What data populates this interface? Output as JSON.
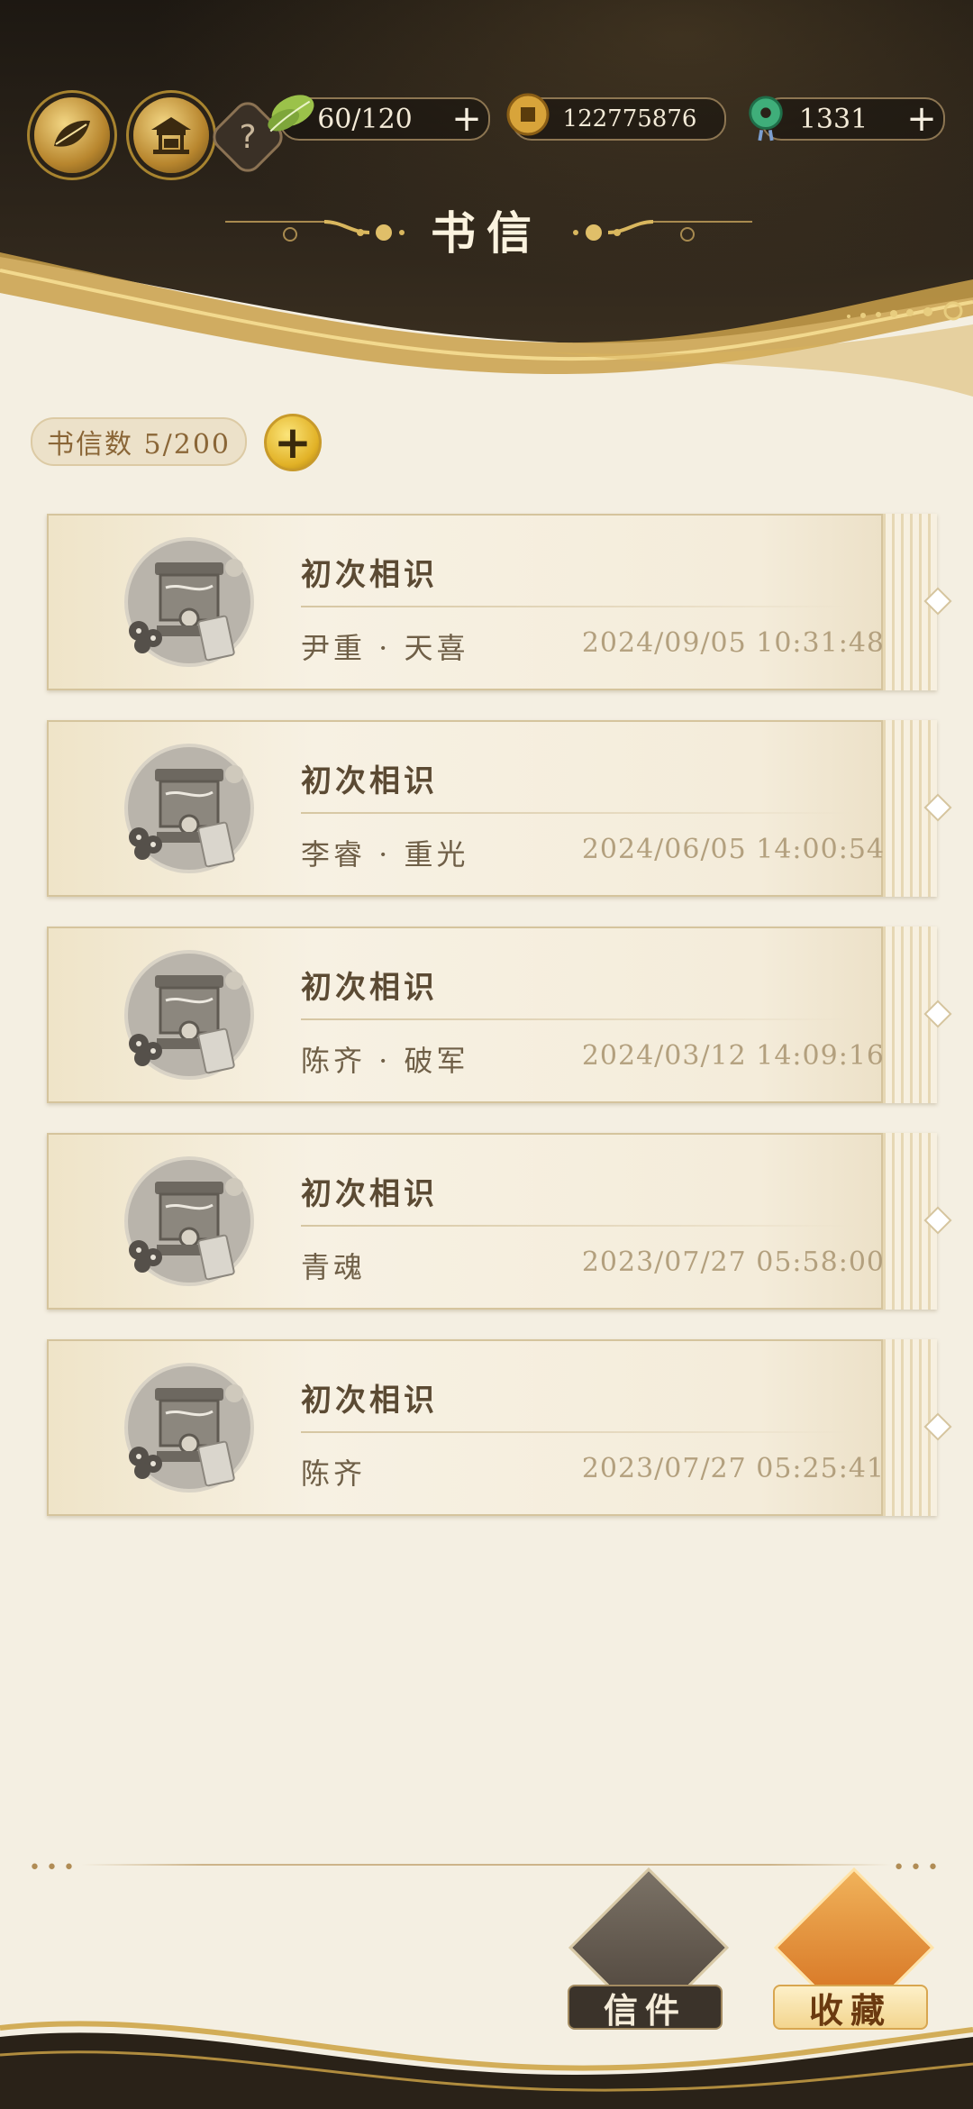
{
  "header": {
    "title": "书信",
    "resources": {
      "stamina": {
        "icon": "leaf-icon",
        "value": "60/120"
      },
      "coins": {
        "icon": "copper-coin-icon",
        "value": "122775876"
      },
      "jade": {
        "icon": "jade-pendant-icon",
        "value": "1331"
      }
    },
    "help_label": "?"
  },
  "counter": {
    "label": "书信数 5/200",
    "add_label": "+"
  },
  "letters": [
    {
      "title": "初次相识",
      "sender": "尹重 · 天喜",
      "time": "2024/09/05 10:31:48"
    },
    {
      "title": "初次相识",
      "sender": "李睿 · 重光",
      "time": "2024/06/05 14:00:54"
    },
    {
      "title": "初次相识",
      "sender": "陈齐 · 破军",
      "time": "2024/03/12 14:09:16"
    },
    {
      "title": "初次相识",
      "sender": "青魂",
      "time": "2023/07/27 05:58:00"
    },
    {
      "title": "初次相识",
      "sender": "陈齐",
      "time": "2023/07/27 05:25:41"
    }
  ],
  "tabs": {
    "mail": "信件",
    "favorites": "收藏"
  },
  "colors": {
    "header_dark": "#2c241a",
    "gold": "#c9a04a",
    "paper": "#f4efe2",
    "active_tab": "#d26a1a"
  }
}
